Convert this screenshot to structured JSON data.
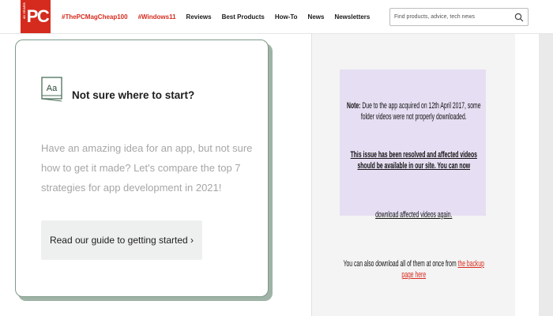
{
  "header": {
    "logo_text": "PC",
    "logo_years": "40 YEARS",
    "nav": [
      {
        "label": "#ThePCMagCheap100",
        "highlight": true
      },
      {
        "label": "#Windows11",
        "highlight": true
      },
      {
        "label": "Reviews",
        "highlight": false
      },
      {
        "label": "Best Products",
        "highlight": false
      },
      {
        "label": "How-To",
        "highlight": false
      },
      {
        "label": "News",
        "highlight": false
      },
      {
        "label": "Newsletters",
        "highlight": false
      }
    ],
    "search_placeholder": "Find products, advice, tech news"
  },
  "card": {
    "icon_text": "Aa",
    "title": "Not sure where to start?",
    "description": "Have an amazing idea for an app, but not sure how to get it made? Let's compare the top 7 strategies for app development in 2021!",
    "cta_label": "Read our guide to getting started ›"
  },
  "notice": {
    "label": "Note:",
    "line1": "Due to the app acquired on 12th April 2017, some folder videos were not properly downloaded.",
    "line2": "This issue has been resolved and affected videos should be available in our site. You can now",
    "line3": "download affected videos again.",
    "line4_prefix": "You can also download all of them at once from",
    "line4_link": "the backup page here"
  },
  "colors": {
    "brand_red": "#d52b1e",
    "card_border": "#7e9a88",
    "notice_bg": "#e6def3"
  }
}
